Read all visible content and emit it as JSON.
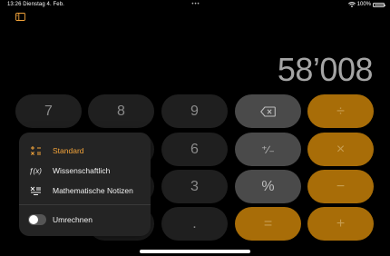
{
  "status_bar": {
    "time": "13:26",
    "date": "Dienstag 4. Feb.",
    "center_dots": "•••",
    "battery": "100%",
    "battery_level": 1.0
  },
  "display": {
    "value": "58’008"
  },
  "keys": {
    "row1": [
      "7",
      "8",
      "9",
      "⌫",
      "÷"
    ],
    "row2": [
      "6",
      "⁺∕₋",
      "×"
    ],
    "row3": [
      "3",
      "%",
      "−"
    ],
    "row4": [
      ".",
      "=",
      "+"
    ]
  },
  "menu": {
    "items": [
      {
        "label": "Standard",
        "icon": "standard-icon",
        "active": true
      },
      {
        "label": "Wissenschaftlich",
        "icon": "function-icon",
        "active": false
      },
      {
        "label": "Mathematische Notizen",
        "icon": "math-notes-icon",
        "active": false
      }
    ],
    "toggle": {
      "label": "Umrechnen",
      "on": false
    }
  },
  "colors": {
    "accent": "#f2a33a",
    "operator_key": "#a86d08",
    "number_key": "#1f1f1f",
    "function_key": "#4a4a4a",
    "background": "#000000"
  }
}
